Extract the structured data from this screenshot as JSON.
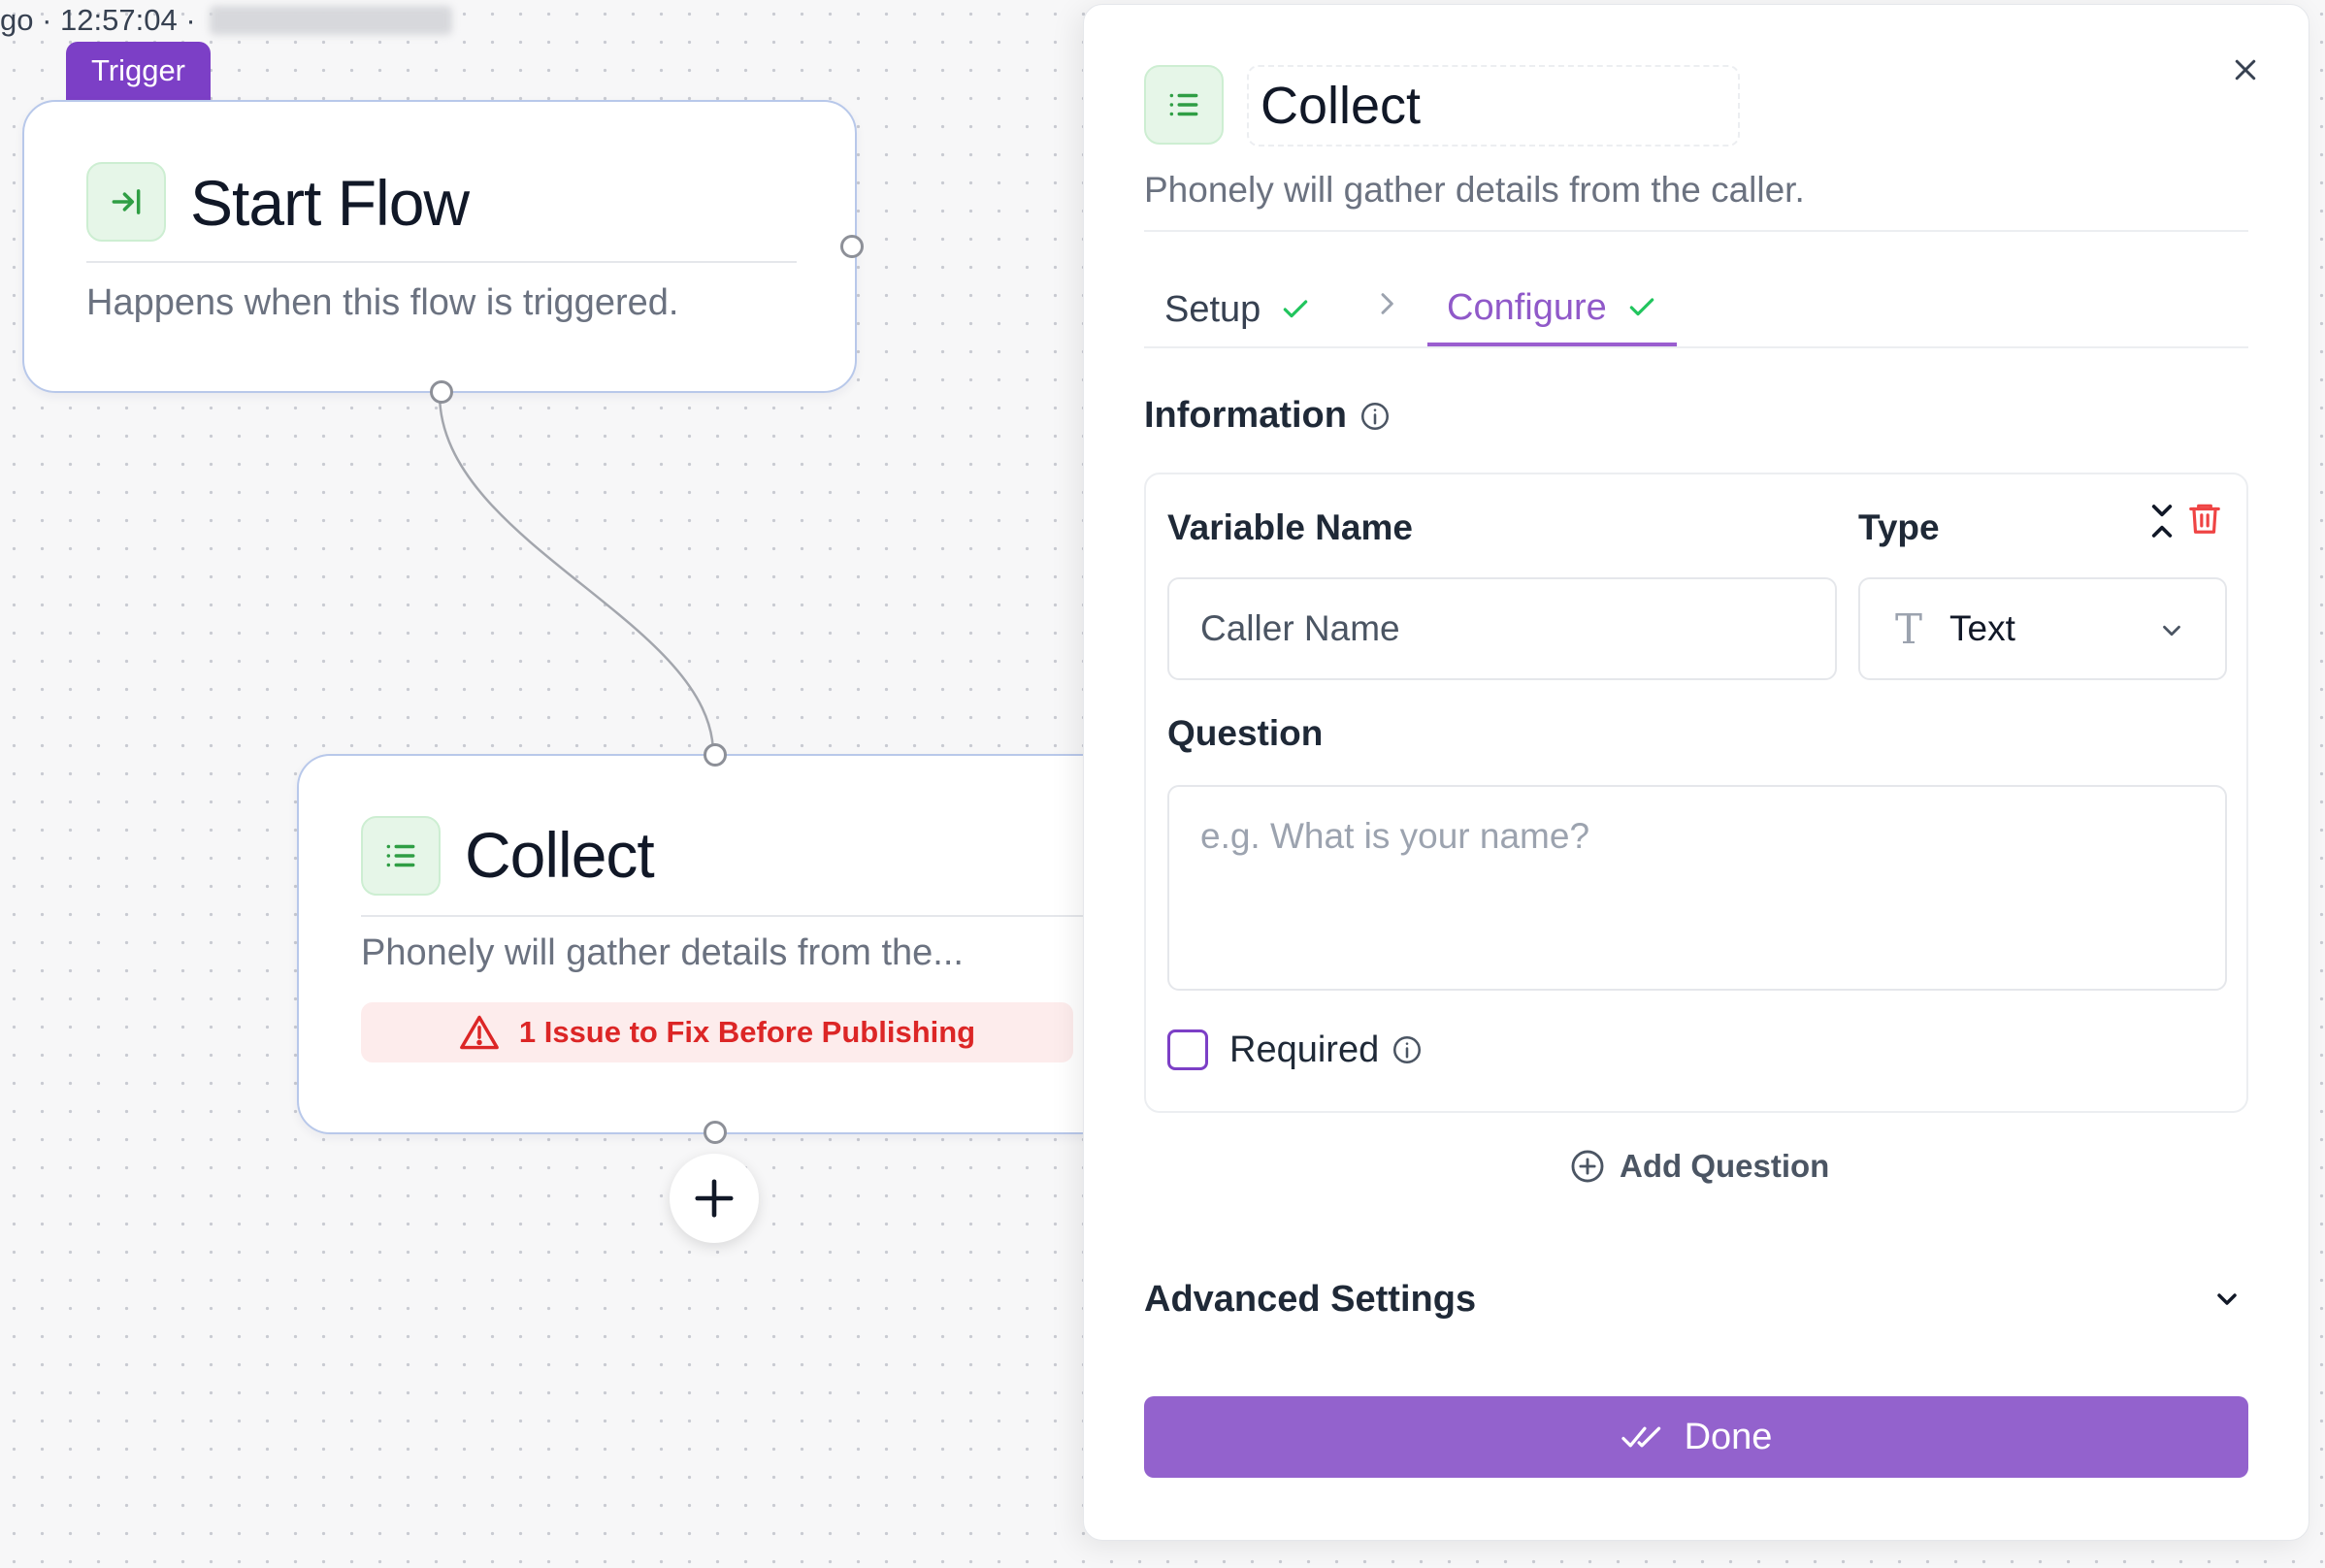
{
  "status_bar": {
    "text": "go · 12:57:04 ·"
  },
  "canvas": {
    "trigger_badge": "Trigger",
    "start_node": {
      "icon": "enter-arrow-icon",
      "title": "Start Flow",
      "description": "Happens when this flow is triggered."
    },
    "collect_node": {
      "icon": "list-icon",
      "title": "Collect",
      "description": "Phonely will gather details from the...",
      "issue": "1 Issue to Fix Before Publishing"
    },
    "add_node_icon": "plus-icon"
  },
  "panel": {
    "icon": "list-icon",
    "title": "Collect",
    "description": "Phonely will gather details from the caller.",
    "tabs": [
      {
        "label": "Setup",
        "complete": true
      },
      {
        "label": "Configure",
        "complete": true,
        "active": true
      }
    ],
    "information_label": "Information",
    "question_card": {
      "variable_name_label": "Variable Name",
      "variable_name_value": "Caller Name",
      "type_label": "Type",
      "type_value": "Text",
      "question_label": "Question",
      "question_placeholder": "e.g. What is your name?",
      "required_label": "Required",
      "required_checked": false
    },
    "add_question_label": "Add Question",
    "advanced_settings_label": "Advanced Settings",
    "done_label": "Done"
  },
  "colors": {
    "accent_purple": "#7c3fc6",
    "done_button": "#9362cd",
    "success_green": "#22c55e",
    "error_red": "#dc2626"
  }
}
